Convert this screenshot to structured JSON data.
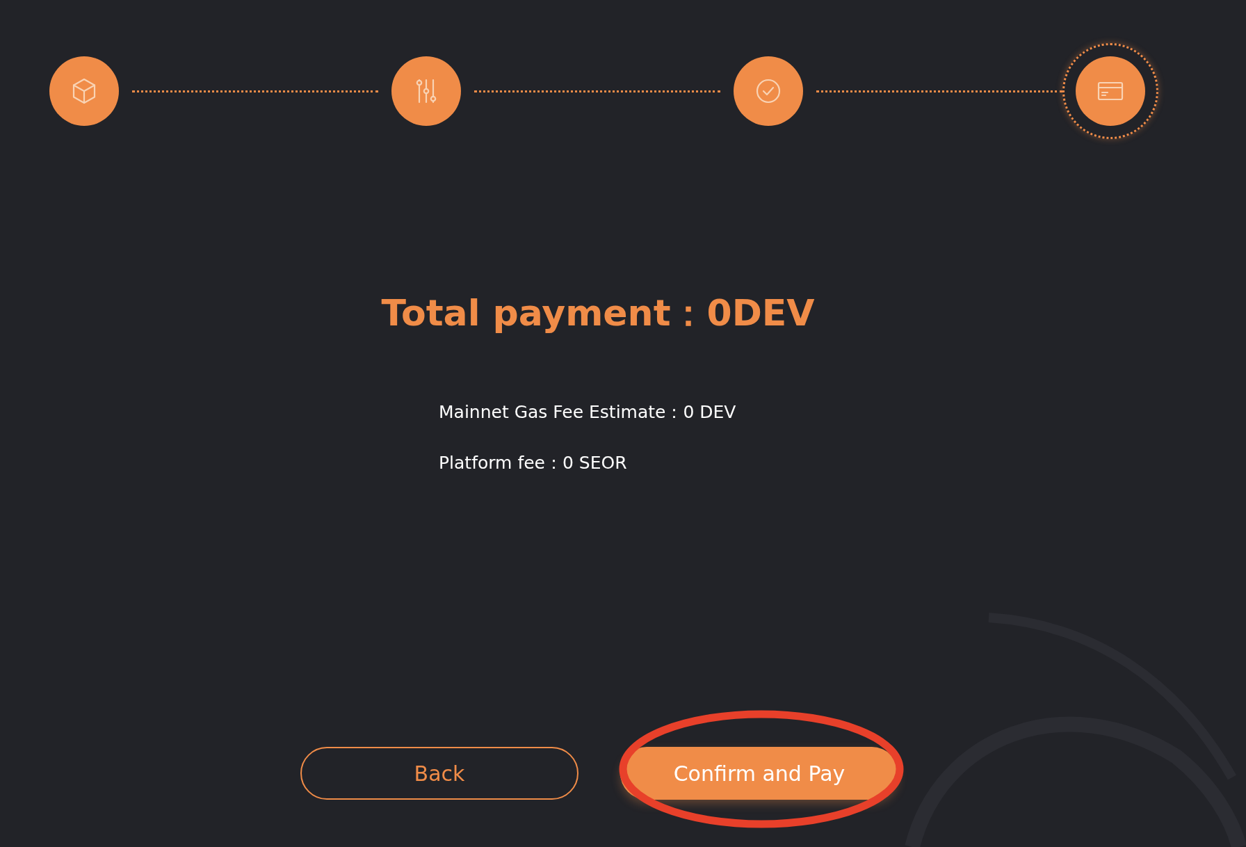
{
  "steps": [
    {
      "kind": "cube",
      "selected": false
    },
    {
      "kind": "sliders",
      "selected": false
    },
    {
      "kind": "check",
      "selected": false
    },
    {
      "kind": "card",
      "selected": true
    }
  ],
  "total": "Total payment：0DEV",
  "fees": [
    "Mainnet Gas Fee Estimate：0 DEV",
    "Platform fee：0 SEOR"
  ],
  "buttons": {
    "back": "Back",
    "confirm": "Confirm and Pay"
  }
}
